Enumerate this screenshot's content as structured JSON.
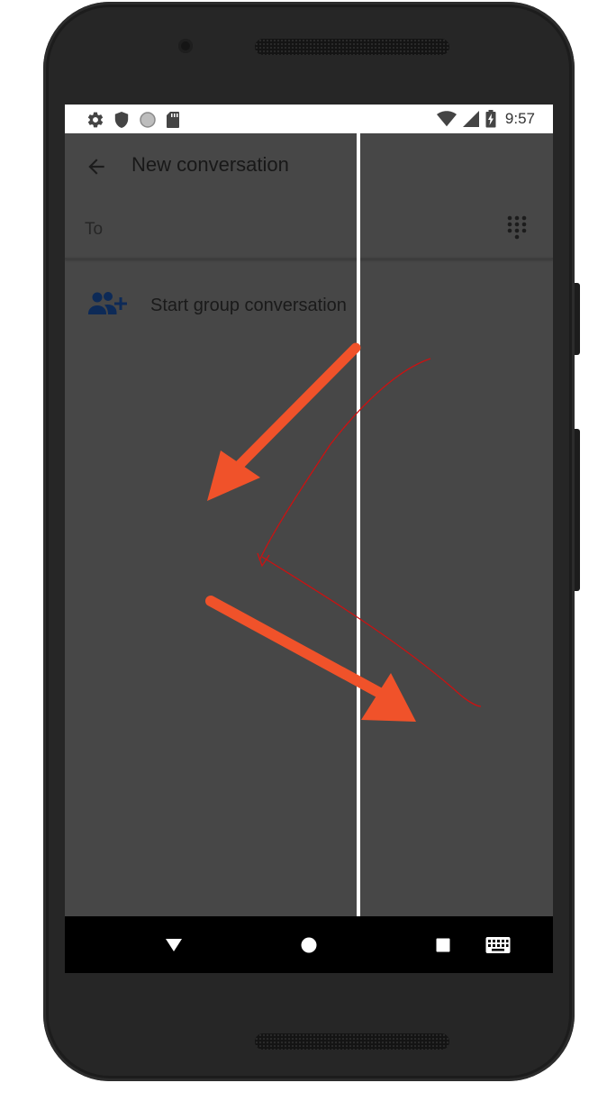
{
  "status_bar": {
    "time": "9:57",
    "left_icons": [
      "settings-icon",
      "shield-icon",
      "circle-icon",
      "sd-card-icon"
    ],
    "right_icons": [
      "wifi-icon",
      "signal-icon",
      "battery-charging-icon"
    ]
  },
  "app_bar": {
    "title": "New conversation",
    "back_icon": "arrow-back-icon"
  },
  "recipient": {
    "to_label": "To",
    "dialpad_icon": "dialpad-icon"
  },
  "group_conversation": {
    "label": "Start group conversation",
    "icon": "group-add-icon",
    "icon_color": "#0d2a57"
  },
  "annotations": {
    "arrow_color": "#f0522a",
    "line_color": "#cc1111",
    "divider_color": "#ffffff"
  },
  "nav_bar": {
    "buttons": [
      "back-triangle-icon",
      "home-circle-icon",
      "recents-square-icon",
      "keyboard-icon"
    ]
  }
}
